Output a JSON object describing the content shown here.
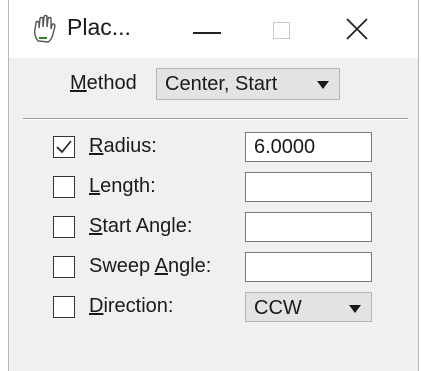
{
  "window": {
    "title": "Plac...",
    "icon": "hand-grab-icon"
  },
  "method": {
    "label_underlined": "M",
    "label_rest": "ethod",
    "value": "Center, Start"
  },
  "params": [
    {
      "checked": true,
      "label_pre": "",
      "label_u": "R",
      "label_post": "adius:",
      "value": "6.0000",
      "type": "text"
    },
    {
      "checked": false,
      "label_pre": "",
      "label_u": "L",
      "label_post": "ength:",
      "value": "",
      "type": "text"
    },
    {
      "checked": false,
      "label_pre": "",
      "label_u": "S",
      "label_post": "tart Angle:",
      "value": "",
      "type": "text"
    },
    {
      "checked": false,
      "label_pre": "Sweep ",
      "label_u": "A",
      "label_post": "ngle:",
      "value": "",
      "type": "text"
    },
    {
      "checked": false,
      "label_pre": "",
      "label_u": "D",
      "label_post": "irection:",
      "value": "CCW",
      "type": "select"
    }
  ]
}
